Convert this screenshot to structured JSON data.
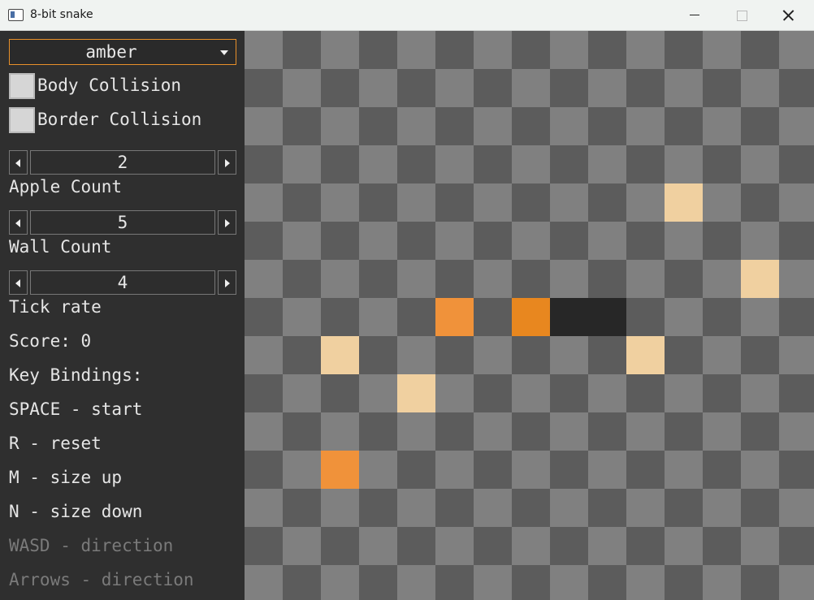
{
  "window": {
    "title": "8-bit snake"
  },
  "panel": {
    "theme_select": {
      "value": "amber"
    },
    "body_collision": {
      "label": "Body Collision",
      "checked": false
    },
    "border_collision": {
      "label": "Border Collision",
      "checked": false
    },
    "apple_count": {
      "value": "2",
      "label": "Apple Count"
    },
    "wall_count": {
      "value": "5",
      "label": "Wall Count"
    },
    "tick_rate": {
      "value": "4",
      "label": "Tick rate"
    },
    "score": "Score: 0",
    "key_bindings_title": "Key Bindings:",
    "bindings": [
      "SPACE - start",
      "R - reset",
      "M - size up",
      "N - size down",
      "WASD - direction",
      "Arrows - direction"
    ]
  },
  "board": {
    "columns": 15,
    "rows": 15,
    "colors": {
      "light_tile": "#808080",
      "dark_tile": "#5c5c5c",
      "apple": "#f0d0a0",
      "wall": "#f0923a",
      "snake_head": "#e8871f",
      "snake_body": "#272727"
    },
    "apples": [
      [
        11,
        4
      ],
      [
        13,
        6
      ],
      [
        2,
        8
      ],
      [
        10,
        8
      ],
      [
        4,
        9
      ]
    ],
    "walls": [
      [
        5,
        7
      ],
      [
        2,
        11
      ]
    ],
    "snake": [
      [
        7,
        7
      ],
      [
        8,
        7
      ],
      [
        9,
        7
      ]
    ]
  }
}
